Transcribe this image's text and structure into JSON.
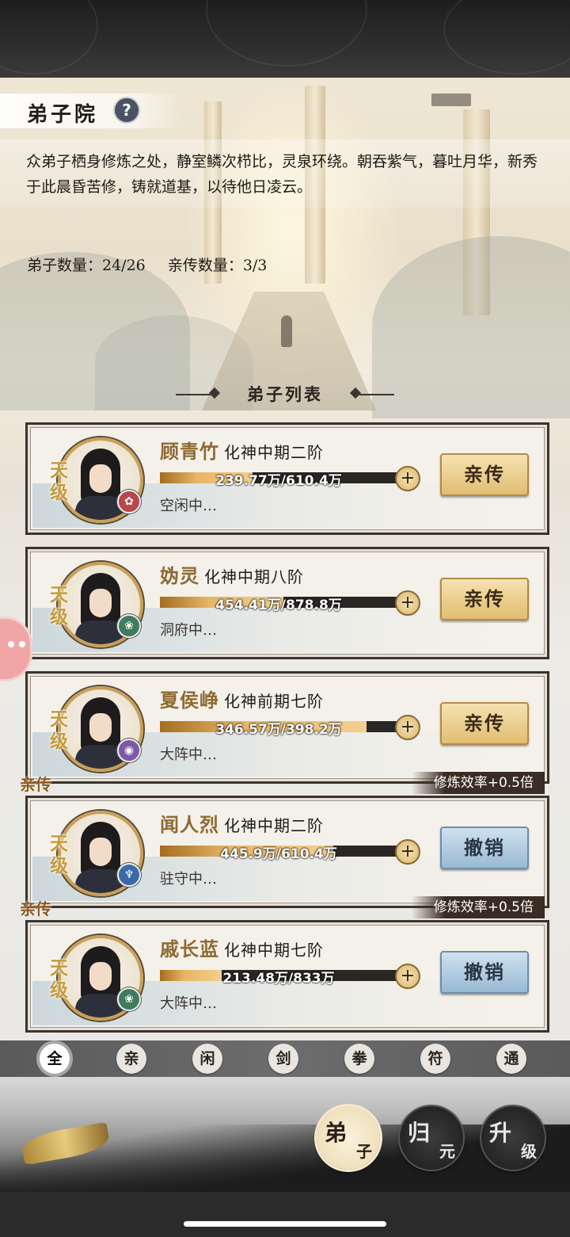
{
  "header": {
    "title": "弟子院",
    "help_glyph": "?",
    "description": "众弟子栖身修炼之处，静室鳞次栉比，灵泉环绕。朝吞紫气，暮吐月华，新秀于此晨昏苦修，铸就道基，以待他日凌云。",
    "disciple_count": "弟子数量：24/26",
    "inner_count": "亲传数量：3/3"
  },
  "list": {
    "title": "弟子列表",
    "disciples": [
      {
        "name": "顾青竹",
        "rank": "化神中期二阶",
        "exp": "239.77万/610.4万",
        "progress": 0.39,
        "status": "空闲中…",
        "grade": "天级",
        "element_color": "#b8474c",
        "element_glyph": "✿",
        "button": "亲传",
        "button_style": "gold",
        "inner": false,
        "inner_tag": "",
        "efficiency": ""
      },
      {
        "name": "妫灵",
        "rank": "化神中期八阶",
        "exp": "454.41万/878.8万",
        "progress": 0.52,
        "status": "洞府中…",
        "grade": "天级",
        "element_color": "#3f7b5f",
        "element_glyph": "❀",
        "button": "亲传",
        "button_style": "gold",
        "inner": false,
        "inner_tag": "",
        "efficiency": ""
      },
      {
        "name": "夏侯峥",
        "rank": "化神前期七阶",
        "exp": "346.57万/398.2万",
        "progress": 0.87,
        "status": "大阵中…",
        "grade": "天级",
        "element_color": "#7e5aa6",
        "element_glyph": "◉",
        "button": "亲传",
        "button_style": "gold",
        "inner": false,
        "inner_tag": "",
        "efficiency": ""
      },
      {
        "name": "闻人烈",
        "rank": "化神中期二阶",
        "exp": "445.9万/610.4万",
        "progress": 0.73,
        "status": "驻守中…",
        "grade": "天级",
        "element_color": "#3b6aa8",
        "element_glyph": "♆",
        "button": "撤销",
        "button_style": "blue",
        "inner": true,
        "inner_tag": "亲传",
        "efficiency": "修炼效率+0.5倍"
      },
      {
        "name": "戚长蓝",
        "rank": "化神中期七阶",
        "exp": "213.48万/833万",
        "progress": 0.26,
        "status": "大阵中…",
        "grade": "天级",
        "element_color": "#3f7b5f",
        "element_glyph": "❀",
        "button": "撤销",
        "button_style": "blue",
        "inner": true,
        "inner_tag": "亲传",
        "efficiency": "修炼效率+0.5倍"
      }
    ]
  },
  "filters": [
    {
      "label": "全",
      "active": true
    },
    {
      "label": "亲",
      "active": false
    },
    {
      "label": "闲",
      "active": false
    },
    {
      "label": "剑",
      "active": false
    },
    {
      "label": "拳",
      "active": false
    },
    {
      "label": "符",
      "active": false
    },
    {
      "label": "通",
      "active": false
    }
  ],
  "bottom_nav": [
    {
      "big": "弟",
      "small": "子",
      "active": true
    },
    {
      "big": "归",
      "small": "元",
      "active": false
    },
    {
      "big": "升",
      "small": "级",
      "active": false
    }
  ]
}
